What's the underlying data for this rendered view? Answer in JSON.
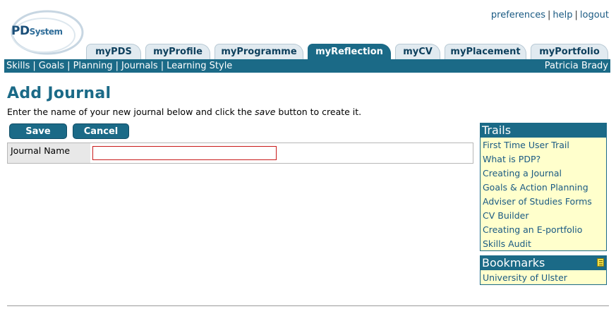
{
  "logo": {
    "main": "PD",
    "sub": "System"
  },
  "top_links": [
    {
      "label": "preferences"
    },
    {
      "label": "help"
    },
    {
      "label": "logout"
    }
  ],
  "tabs": [
    {
      "label": "myPDS",
      "active": false
    },
    {
      "label": "myProfile",
      "active": false
    },
    {
      "label": "myProgramme",
      "active": false
    },
    {
      "label": "myReflection",
      "active": true
    },
    {
      "label": "myCV",
      "active": false
    },
    {
      "label": "myPlacement",
      "active": false
    },
    {
      "label": "myPortfolio",
      "active": false
    }
  ],
  "subnav": {
    "items": [
      "Skills",
      "Goals",
      "Planning",
      "Journals",
      "Learning Style"
    ],
    "user": "Patricia Brady"
  },
  "main": {
    "title": "Add Journal",
    "intro_before": "Enter the name of your new journal below and click the ",
    "intro_em": "save",
    "intro_after": " button to create it.",
    "save_label": "Save",
    "cancel_label": "Cancel",
    "field_label": "Journal Name",
    "field_value": ""
  },
  "trails": {
    "title": "Trails",
    "items": [
      "First Time User Trail",
      "What is PDP?",
      "Creating a Journal",
      "Goals & Action Planning",
      "Adviser of Studies Forms",
      "CV Builder",
      "Creating an E-portfolio",
      "Skills Audit"
    ]
  },
  "bookmarks": {
    "title": "Bookmarks",
    "items": [
      "University of Ulster"
    ]
  },
  "colors": {
    "accent": "#1b6a87",
    "sidebar_bg": "#ffffcc",
    "input_border": "#c91a1a"
  }
}
